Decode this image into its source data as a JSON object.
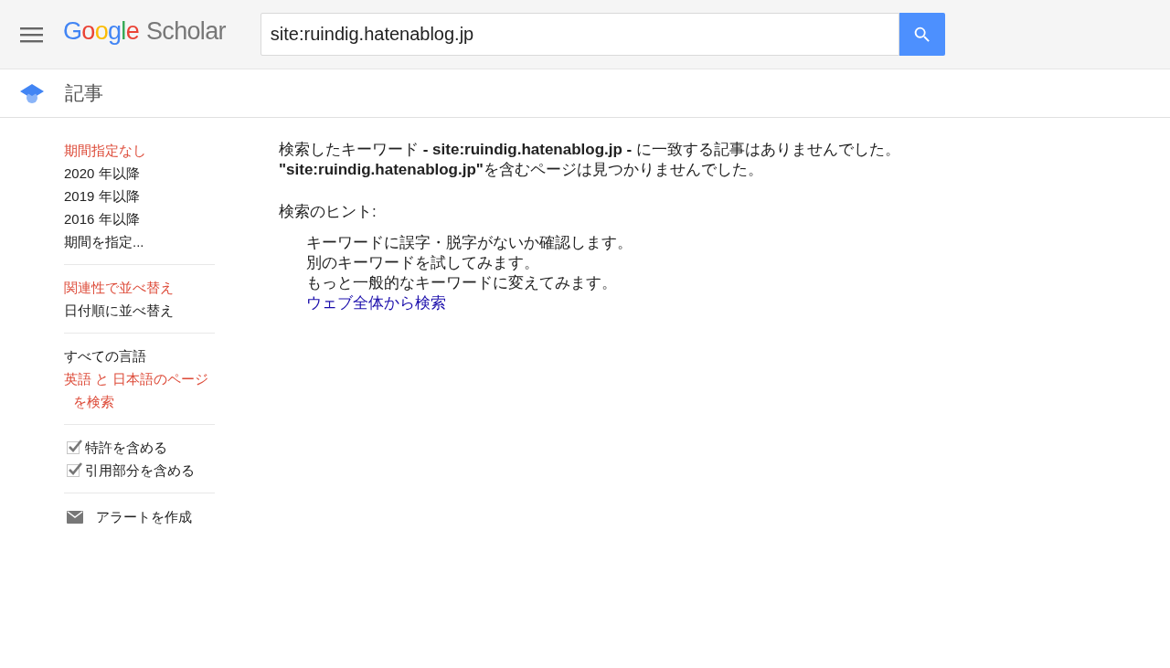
{
  "header": {
    "logo": {
      "brand": "Google",
      "product": "Scholar"
    },
    "search": {
      "value": "site:ruindig.hatenablog.jp"
    }
  },
  "subheader": {
    "title": "記事"
  },
  "sidebar": {
    "groups": [
      {
        "kind": "links",
        "items": [
          {
            "label": "期間指定なし",
            "selected": true
          },
          {
            "label": "2020 年以降",
            "selected": false
          },
          {
            "label": "2019 年以降",
            "selected": false
          },
          {
            "label": "2016 年以降",
            "selected": false
          },
          {
            "label": "期間を指定...",
            "selected": false
          }
        ]
      },
      {
        "kind": "links",
        "items": [
          {
            "label": "関連性で並べ替え",
            "selected": true
          },
          {
            "label": "日付順に並べ替え",
            "selected": false
          }
        ]
      },
      {
        "kind": "links",
        "items": [
          {
            "label": "すべての言語",
            "selected": false
          },
          {
            "label": "英語 と 日本語のページを検索",
            "selected": true
          }
        ]
      },
      {
        "kind": "checkboxes",
        "items": [
          {
            "label": "特許を含める",
            "checked": true
          },
          {
            "label": "引用部分を含める",
            "checked": true
          }
        ]
      },
      {
        "kind": "alert",
        "items": [
          {
            "label": "アラートを作成"
          }
        ]
      }
    ]
  },
  "results": {
    "messages": [
      "検索したキーワード **- site:ruindig.hatenablog.jp -** に一致する記事はありませんでした。",
      "**\"site:ruindig.hatenablog.jp\"**を含むページは見つかりませんでした。"
    ],
    "hints_heading": "検索のヒント:",
    "hints": [
      "キーワードに誤字・脱字がないか確認します。",
      "別のキーワードを試してみます。",
      "もっと一般的なキーワードに変えてみます。"
    ],
    "web_search_link": "ウェブ全体から検索"
  }
}
